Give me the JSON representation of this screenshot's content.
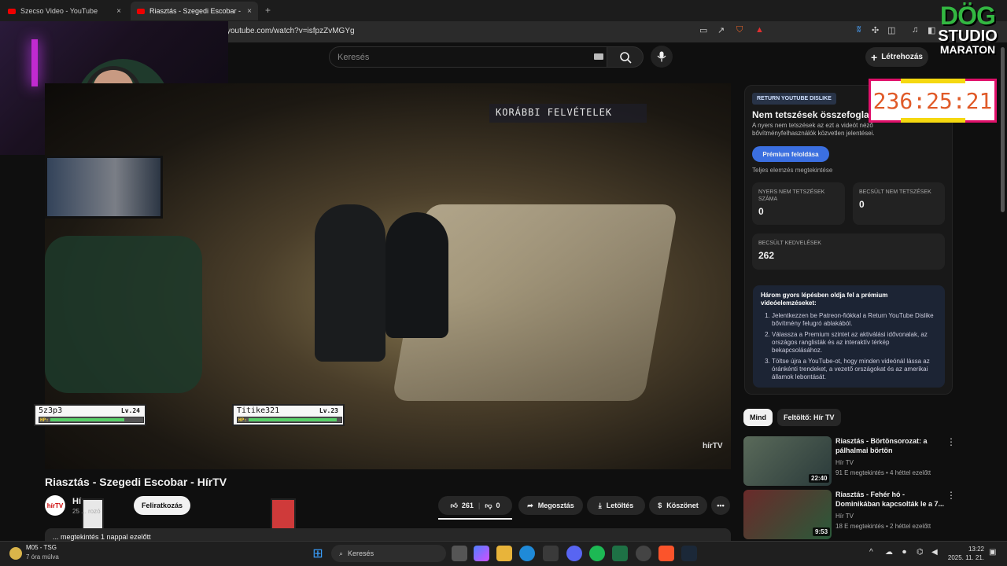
{
  "browser": {
    "tabs": [
      {
        "label": "Szecso Video - YouTube",
        "close": "×"
      },
      {
        "label": "Riasztás - Szegedi Escobar - H",
        "close": "×"
      }
    ],
    "new_tab": "+",
    "url": "youtube.com/watch?v=isfpzZvMGYg"
  },
  "header": {
    "search_placeholder": "Keresés",
    "create_label": "Létrehozás"
  },
  "logo": {
    "line1": "DÖG",
    "line2": "STUDIO",
    "line3": "MARATON"
  },
  "timer": "236:25:21",
  "video": {
    "overlay_text": "KORÁBBI FELVÉTELEK",
    "watermark": "hírTV",
    "game_overlays": [
      {
        "name": "5z3p3",
        "level": "Lv.24",
        "hp": "HP:",
        "hp_fraction": 0.8
      },
      {
        "name": "Titike321",
        "level": "Lv.23",
        "hp": "HP:",
        "hp_fraction": 0.95
      }
    ]
  },
  "video_info": {
    "title": "Riasztás - Szegedi Escobar - HírTV",
    "channel_avatar": "hírTV",
    "channel_name": "Hí",
    "subscribers": "25 ... rozó",
    "subscribe": "Feliratkozás",
    "likes": "261",
    "dislikes": "0",
    "share": "Megosztás",
    "download": "Letöltés",
    "thanks": "Köszönet",
    "more": "•••",
    "description_line": "... megtekintés  1 nappal ezelőtt"
  },
  "ryd": {
    "badge": "RETURN YOUTUBE DISLIKE",
    "title": "Nem tetszések összefoglalója",
    "desc": "A nyers nem tetszések az ezt a videót néző bővítményfelhasználók közvetlen jelentései.",
    "premium_button": "Prémium feloldása",
    "full_analysis": "Teljes elemzés megtekintése",
    "stats": [
      {
        "label": "NYERS NEM TETSZÉSEK SZÁMA",
        "value": "0"
      },
      {
        "label": "BECSÜLT NEM TETSZÉSEK",
        "value": "0"
      },
      {
        "label": "BECSÜLT KEDVELÉSEK",
        "value": "262"
      }
    ],
    "howto_title": "Három gyors lépésben oldja fel a prémium videóelemzéseket:",
    "howto_steps": [
      "Jelentkezzen be Patreon-fiókkal a Return YouTube Dislike bővítmény felugró ablakából.",
      "Válassza a Premium szintet az aktiválási idővonalak, az országos ranglisták és az interaktív térkép bekapcsolásához.",
      "Töltse újra a YouTube-ot, hogy minden videónál lássa az óránkénti trendeket, a vezető országokat és az amerikai államok lebontását."
    ]
  },
  "filters": [
    "Mind",
    "Feltöltő: Hír TV"
  ],
  "recommendations": [
    {
      "title": "Riasztás - Börtönsorozat: a pálhalmai börtön",
      "channel": "Hír TV",
      "meta": "91 E megtekintés • 4 héttel ezelőtt",
      "duration": "22:40"
    },
    {
      "title": "Riasztás - Fehér hó - Dominikában kapcsolták le a 7...",
      "channel": "Hír TV",
      "meta": "18 E megtekintés • 2 héttel ezelőtt",
      "duration": "9:53"
    }
  ],
  "taskbar": {
    "weather_title": "M05 - TSG",
    "weather_sub": "7 óra múlva",
    "search": "Keresés",
    "time": "13:22",
    "date": "2025. 11. 21."
  }
}
